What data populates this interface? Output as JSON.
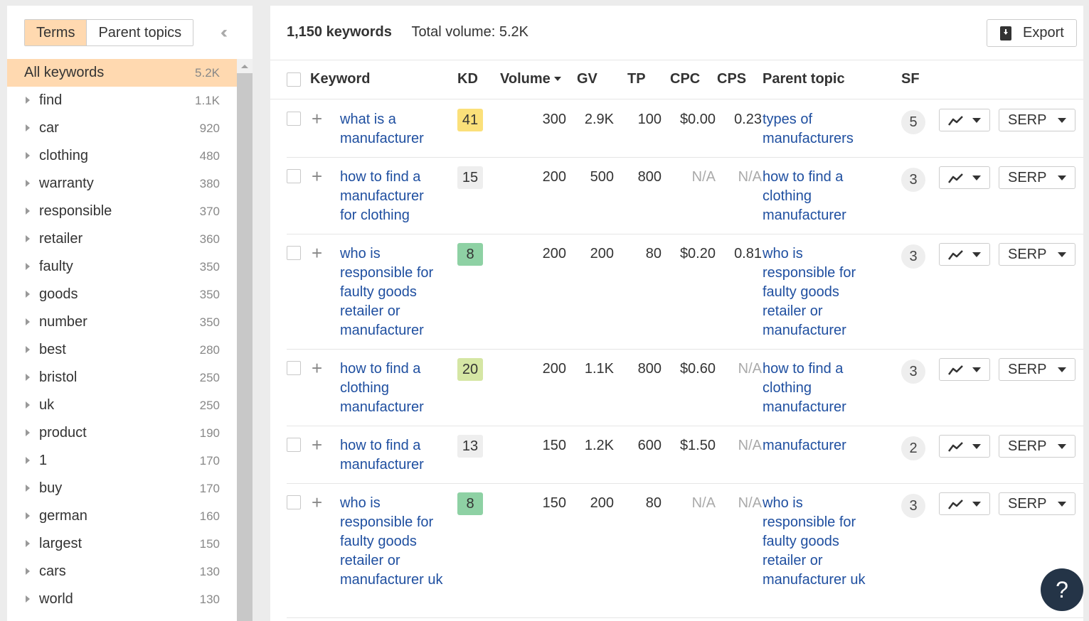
{
  "sidebar": {
    "tabs": [
      {
        "label": "Terms",
        "active": true
      },
      {
        "label": "Parent topics",
        "active": false
      }
    ],
    "collapse_icon": "double-chevron-left-icon",
    "all_keywords": {
      "label": "All keywords",
      "count": "5.2K"
    },
    "terms": [
      {
        "label": "find",
        "count": "1.1K"
      },
      {
        "label": "car",
        "count": "920"
      },
      {
        "label": "clothing",
        "count": "480"
      },
      {
        "label": "warranty",
        "count": "380"
      },
      {
        "label": "responsible",
        "count": "370"
      },
      {
        "label": "retailer",
        "count": "360"
      },
      {
        "label": "faulty",
        "count": "350"
      },
      {
        "label": "goods",
        "count": "350"
      },
      {
        "label": "number",
        "count": "350"
      },
      {
        "label": "best",
        "count": "280"
      },
      {
        "label": "bristol",
        "count": "250"
      },
      {
        "label": "uk",
        "count": "250"
      },
      {
        "label": "product",
        "count": "190"
      },
      {
        "label": "1",
        "count": "170"
      },
      {
        "label": "buy",
        "count": "170"
      },
      {
        "label": "german",
        "count": "160"
      },
      {
        "label": "largest",
        "count": "150"
      },
      {
        "label": "cars",
        "count": "130"
      },
      {
        "label": "world",
        "count": "130"
      }
    ]
  },
  "main": {
    "keyword_count": "1,150 keywords",
    "total_volume": "Total volume: 5.2K",
    "export_label": "Export",
    "columns": {
      "keyword": "Keyword",
      "kd": "KD",
      "volume": "Volume",
      "gv": "GV",
      "tp": "TP",
      "cpc": "CPC",
      "cps": "CPS",
      "parent_topic": "Parent topic",
      "sf": "SF"
    },
    "serp_label": "SERP",
    "rows": [
      {
        "keyword": "what is a manufacturer",
        "kd": "41",
        "kd_color": "#fbe07a",
        "volume": "300",
        "gv": "2.9K",
        "tp": "100",
        "cpc": "$0.00",
        "cps": "0.23",
        "parent_topic": "types of manufacturers",
        "sf": "5"
      },
      {
        "keyword": "how to find a manufacturer for clothing",
        "kd": "15",
        "kd_color": "#eeeeee",
        "volume": "200",
        "gv": "500",
        "tp": "800",
        "cpc": "N/A",
        "cps": "N/A",
        "parent_topic": "how to find a clothing manufacturer",
        "sf": "3"
      },
      {
        "keyword": "who is responsible for faulty goods retailer or manufacturer",
        "kd": "8",
        "kd_color": "#8ed1a4",
        "volume": "200",
        "gv": "200",
        "tp": "80",
        "cpc": "$0.20",
        "cps": "0.81",
        "parent_topic": "who is responsible for faulty goods retailer or manufacturer",
        "sf": "3"
      },
      {
        "keyword": "how to find a clothing manufacturer",
        "kd": "20",
        "kd_color": "#d5e6a4",
        "volume": "200",
        "gv": "1.1K",
        "tp": "800",
        "cpc": "$0.60",
        "cps": "N/A",
        "parent_topic": "how to find a clothing manufacturer",
        "sf": "3"
      },
      {
        "keyword": "how to find a manufacturer",
        "kd": "13",
        "kd_color": "#eeeeee",
        "volume": "150",
        "gv": "1.2K",
        "tp": "600",
        "cpc": "$1.50",
        "cps": "N/A",
        "parent_topic": "manufacturer",
        "sf": "2"
      },
      {
        "keyword": "who is responsible for faulty goods retailer or manufacturer uk",
        "kd": "8",
        "kd_color": "#8ed1a4",
        "volume": "150",
        "gv": "200",
        "tp": "80",
        "cpc": "N/A",
        "cps": "N/A",
        "parent_topic": "who is responsible for faulty goods retailer or manufacturer uk",
        "sf": "3"
      }
    ]
  },
  "help_label": "?"
}
